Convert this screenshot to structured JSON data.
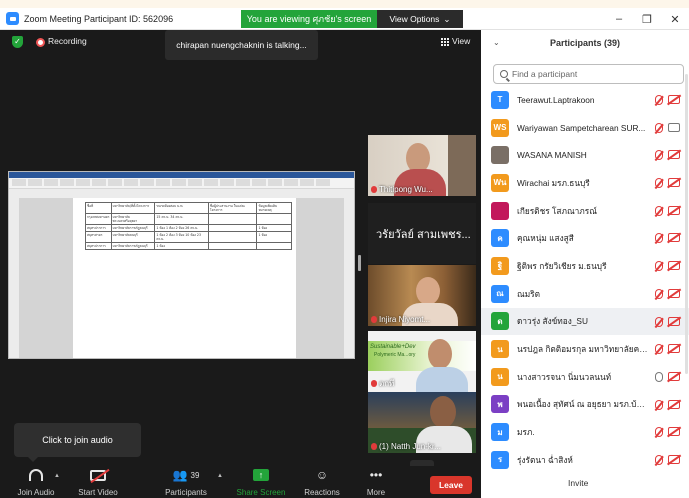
{
  "window": {
    "title": "Zoom Meeting Participant ID: 562096",
    "viewing_banner": "You are viewing ศุภชัย's screen",
    "view_options": "View Options",
    "minimize": "–",
    "maximize": "❐",
    "close": "✕"
  },
  "meeting": {
    "recording_label": "Recording",
    "view_label": "View",
    "talking_toast": "chirapan nuengchaknin is talking...",
    "join_tooltip": "Click to join audio"
  },
  "shared_document": {
    "rows": [
      [
        "ชื่อที่",
        "มหาวิทยาลัย/ที่ตั้งโครงการ",
        "ขนาดห้องสอบ ม.ท.",
        "ชื่อผู้ประสานงาน ในแต่ละโครงการ",
        "ข้อมูลเพิ่มเติม หมายเหตุ"
      ],
      [
        "กรุงเทพมหานคร",
        "มหาวิทยาลัยพระนครศรีอยุธยา",
        "15 ตร.ม. 34 ตร.ม.",
        "",
        ""
      ],
      [
        "สมุทรปราการ",
        "มหาวิทยาลัยราชภัฏธนบุรี",
        "1 ห้อง 1 ห้อง 2 ห้อง 26 ตร.ม.",
        "",
        "1 ห้อง"
      ],
      [
        "สมุทรสาคร",
        "มหาวิทยาลัยธนบุรี",
        "1 ห้อง 2 ห้อง 3 ห้อง 10 ห้อง 23 ตร.ม.",
        "",
        "1 ห้อง"
      ],
      [
        "สมุทรปราการ",
        "มหาวิทยาลัยราชภัฏธนบุรี",
        "1 ห้อง",
        "",
        ""
      ]
    ]
  },
  "video_tiles": [
    {
      "name": "Thitipong Wu..."
    },
    {
      "name": "วรัยวัลย์ สามเพชร..."
    },
    {
      "name": "Injira Niyomt..."
    },
    {
      "name": "ตกที",
      "brand_text": "Sustainable+Dev",
      "brand_sub": "Polymeric Ma...ory"
    },
    {
      "name": "(1) Natth Jun-kr..."
    }
  ],
  "toolbar": {
    "join_audio": "Join Audio",
    "start_video": "Start Video",
    "participants": "Participants",
    "participants_count": "39",
    "share_screen": "Share Screen",
    "reactions": "Reactions",
    "more": "More",
    "leave": "Leave"
  },
  "participants_panel": {
    "title": "Participants (39)",
    "search_placeholder": "Find a participant",
    "invite": "Invite",
    "participants": [
      {
        "initials": "T",
        "name": "Teerawut.Laptrakoon",
        "color": "#2d8cff",
        "mic": "muted",
        "cam": "off"
      },
      {
        "initials": "WS",
        "name": "Wariyawan Sampetcharean SUR...",
        "color": "#f29a1d",
        "mic": "muted",
        "cam": "on"
      },
      {
        "initials": "",
        "name": "WASANA MANISH",
        "color": "#7a6f66",
        "mic": "muted",
        "cam": "off"
      },
      {
        "initials": "Wน",
        "name": "Wirachai มรภ.ธนบุรี",
        "color": "#f29a1d",
        "mic": "muted",
        "cam": "off"
      },
      {
        "initials": "",
        "name": "เกียรติชร โสภณาภรณ์",
        "color": "#c2185b",
        "mic": "muted",
        "cam": "off"
      },
      {
        "initials": "ค",
        "name": "คุณหนุ่ม แสงสูสี",
        "color": "#2d8cff",
        "mic": "muted",
        "cam": "off"
      },
      {
        "initials": "ฐิ",
        "name": "ฐิติพร กรัยวิเชียร ม.ธนบุรี",
        "color": "#f29a1d",
        "mic": "muted",
        "cam": "off"
      },
      {
        "initials": "ณ",
        "name": "ณมริต",
        "color": "#2d8cff",
        "mic": "muted",
        "cam": "off"
      },
      {
        "initials": "ด",
        "name": "ดาวรุ่ง สังข์ทอง_SU",
        "color": "#23a43a",
        "mic": "muted",
        "cam": "off"
      },
      {
        "initials": "น",
        "name": "นรปฎล กิตติอมรกุล มหาวิทยาลัยคริสเ...",
        "color": "#f29a1d",
        "mic": "muted",
        "cam": "off"
      },
      {
        "initials": "น",
        "name": "นางสาวรจนา นิ่มนวลนนท์",
        "color": "#f29a1d",
        "mic": "on",
        "cam": "off"
      },
      {
        "initials": "พ",
        "name": "พนอเนื้อง สุทัศน์ ณ อยุธยา มรภ.บ้าน...",
        "color": "#7b3fc4",
        "mic": "muted",
        "cam": "off"
      },
      {
        "initials": "ม",
        "name": "มรภ.",
        "color": "#2d8cff",
        "mic": "muted",
        "cam": "off"
      },
      {
        "initials": "ร",
        "name": "รุ่งรัตนา ฉ่ำสิงห์",
        "color": "#2d8cff",
        "mic": "muted",
        "cam": "off"
      }
    ]
  }
}
